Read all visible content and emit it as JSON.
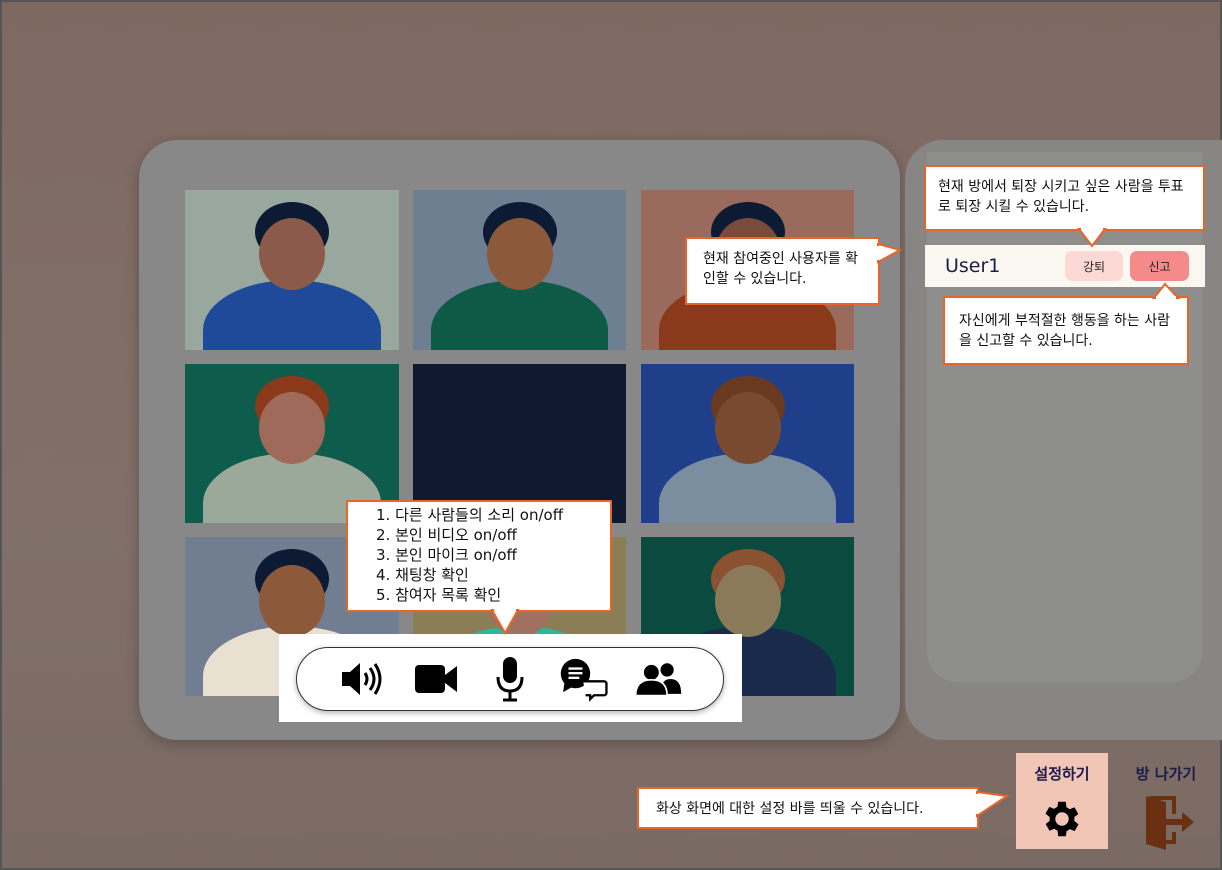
{
  "video_grid": {
    "tiles": [
      {
        "bg": "#98a89e",
        "head": "#8c5a4a",
        "hair": "#0d1a33",
        "shirt": "#1f4a9a"
      },
      {
        "bg": "#6d7f91",
        "head": "#8c5a3a",
        "hair": "#0d1a33",
        "shirt": "#0e5a46"
      },
      {
        "bg": "#9a6a5c",
        "head": "#7a4a3a",
        "hair": "#0d1a33",
        "shirt": "#8a3a1a"
      },
      {
        "bg": "#0e5c4b",
        "head": "#a06a5a",
        "hair": "#8a3a1a",
        "shirt": "#9aa99a"
      },
      {
        "bg": "#0f1a31",
        "head": "#0f1a31",
        "hair": "#0f1a31",
        "shirt": "#0f1a31"
      },
      {
        "bg": "#1f3f8a",
        "head": "#7a4a30",
        "hair": "#6a3a20",
        "shirt": "#7a8ea0"
      },
      {
        "bg": "#717d90",
        "head": "#8c5a3a",
        "hair": "#0d1a33",
        "shirt": "#e8e0d0"
      },
      {
        "bg": "#8b7e57",
        "head": "#a07060",
        "hair": "#0d1a33",
        "shirt": "#2ab79a"
      },
      {
        "bg": "#0b4a3f",
        "head": "#8a7a5a",
        "hair": "#8a5230",
        "shirt": "#1a2a4a"
      }
    ]
  },
  "controls": {
    "icons": [
      "speaker-icon",
      "video-camera-icon",
      "microphone-icon",
      "chat-icon",
      "participants-icon"
    ],
    "callout_lines": [
      "1. 다른 사람들의 소리 on/off",
      "2. 본인 비디오 on/off",
      "3. 본인 마이크 on/off",
      "4. 채팅창 확인",
      "5. 참여자 목록 확인"
    ]
  },
  "participants": {
    "callout": "현재 참여중인 사용자를 확인할 수 있습니다.",
    "kick_callout": "현재 방에서 퇴장 시키고 싶은 사람을 투표로 퇴장 시킬 수 있습니다.",
    "report_callout": "자신에게 부적절한 행동을 하는 사람을 신고할 수 있습니다.",
    "users": [
      {
        "name": "User1",
        "kick_label": "강퇴",
        "report_label": "신고"
      }
    ],
    "colors": {
      "kick": "#fdd9d6",
      "report": "#f58a8a"
    }
  },
  "settings": {
    "label": "설정하기",
    "callout": "화상 화면에 대한 설정 바를 띄울 수 있습니다."
  },
  "exit": {
    "label": "방 나가기"
  },
  "accent": "#e8652a"
}
